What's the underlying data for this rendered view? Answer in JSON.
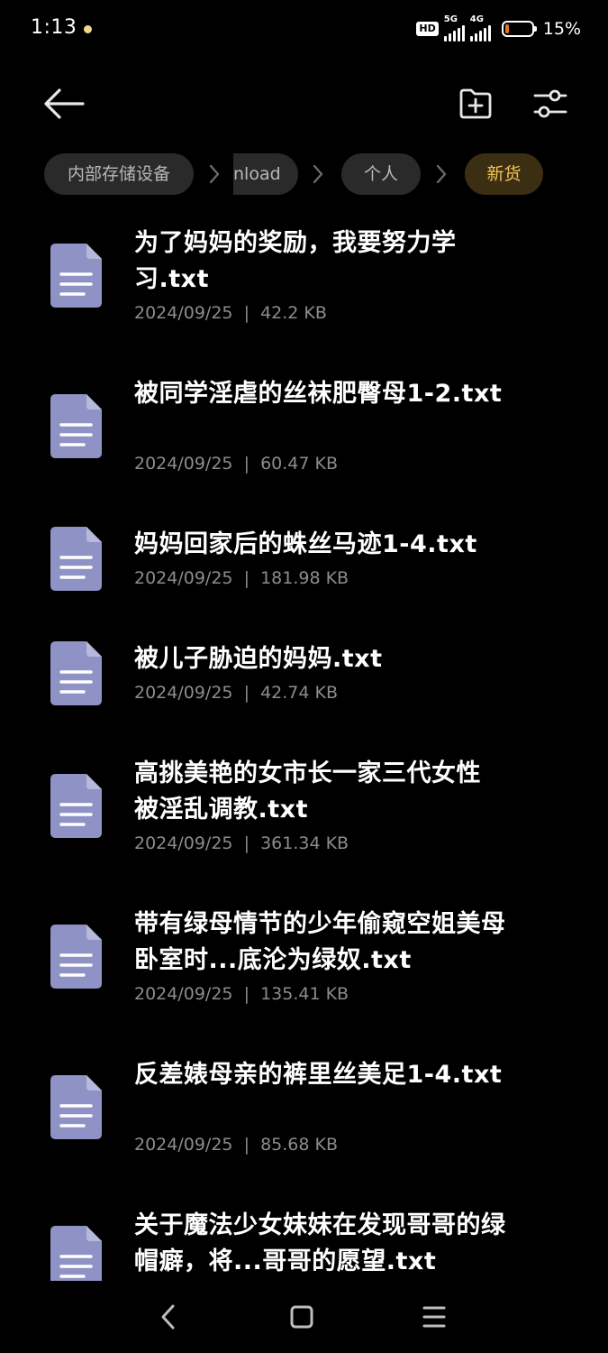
{
  "status_bar": {
    "time": "1:13",
    "hd_label": "HD",
    "net1_label": "5G",
    "net2_label": "4G",
    "battery_text": "15%",
    "battery_level_pct": 15,
    "battery_color": "#e9732b"
  },
  "top_bar": {
    "back_icon": "arrow-left-icon",
    "new_folder_icon": "folder-plus-icon",
    "filter_icon": "sliders-icon"
  },
  "breadcrumb": {
    "items": [
      {
        "label": "内部存储设备"
      },
      {
        "label": "nload"
      },
      {
        "label": "个人"
      },
      {
        "label": "新货"
      }
    ],
    "active_color": "#f1c35a"
  },
  "files": [
    {
      "name": "为了妈妈的奖励，我要努力学习.txt",
      "date": "2024/09/25",
      "size": "42.2 KB"
    },
    {
      "name": "被同学淫虐的丝袜肥臀母1-2.txt",
      "date": "2024/09/25",
      "size": "60.47 KB"
    },
    {
      "name": "妈妈回家后的蛛丝马迹1-4.txt",
      "date": "2024/09/25",
      "size": "181.98 KB"
    },
    {
      "name": "被儿子胁迫的妈妈.txt",
      "date": "2024/09/25",
      "size": "42.74 KB"
    },
    {
      "name": "高挑美艳的女市长一家三代女性被淫乱调教.txt",
      "date": "2024/09/25",
      "size": "361.34 KB"
    },
    {
      "name": "带有绿母情节的少年偷窥空姐美母卧室时...底沦为绿奴.txt",
      "date": "2024/09/25",
      "size": "135.41 KB"
    },
    {
      "name": "反差婊母亲的裤里丝美足1-4.txt",
      "date": "2024/09/25",
      "size": "85.68 KB"
    },
    {
      "name": "关于魔法少女妹妹在发现哥哥的绿帽癖，将...哥哥的愿望.txt",
      "date": "",
      "size": ""
    }
  ],
  "nav_bar": {
    "back_icon": "chevron-left-icon",
    "home_icon": "square-icon",
    "recents_icon": "menu-icon"
  }
}
